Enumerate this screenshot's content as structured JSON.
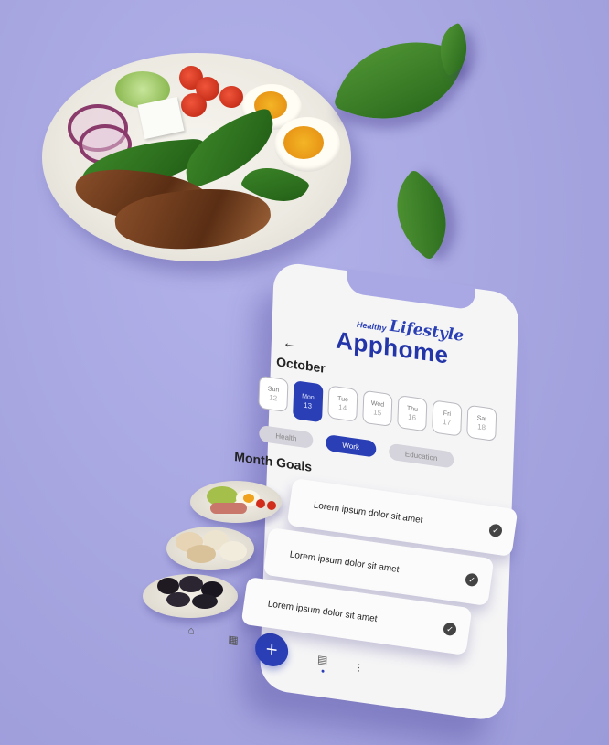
{
  "brand": {
    "prefix": "Healthy",
    "script": "Lifestyle",
    "name": "Apphome"
  },
  "header": {
    "back_icon": "←",
    "month": "October"
  },
  "days": [
    {
      "label": "Sun",
      "num": "12",
      "active": false
    },
    {
      "label": "Mon",
      "num": "13",
      "active": true
    },
    {
      "label": "Tue",
      "num": "14",
      "active": false
    },
    {
      "label": "Wed",
      "num": "15",
      "active": false
    },
    {
      "label": "Thu",
      "num": "16",
      "active": false
    },
    {
      "label": "Fri",
      "num": "17",
      "active": false
    },
    {
      "label": "Sat",
      "num": "18",
      "active": false
    }
  ],
  "categories": [
    {
      "label": "Health",
      "active": false
    },
    {
      "label": "Work",
      "active": true
    },
    {
      "label": "Education",
      "active": false
    }
  ],
  "goals": {
    "title": "Month Goals",
    "items": [
      {
        "text": "Lorem ipsum dolor sit amet",
        "check_icon": "check-circle-icon"
      },
      {
        "text": "Lorem ipsum dolor sit amet",
        "check_icon": "check-circle-icon"
      },
      {
        "text": "Lorem ipsum dolor sit amet",
        "check_icon": "check-circle-icon"
      }
    ]
  },
  "nav": {
    "items": [
      "home-icon",
      "calendar-icon",
      "add-icon",
      "calendar-list-icon",
      "settings-sliders-icon"
    ],
    "fab_label": "+"
  },
  "colors": {
    "accent": "#2a3fb5",
    "background": "#a9a8e4"
  }
}
